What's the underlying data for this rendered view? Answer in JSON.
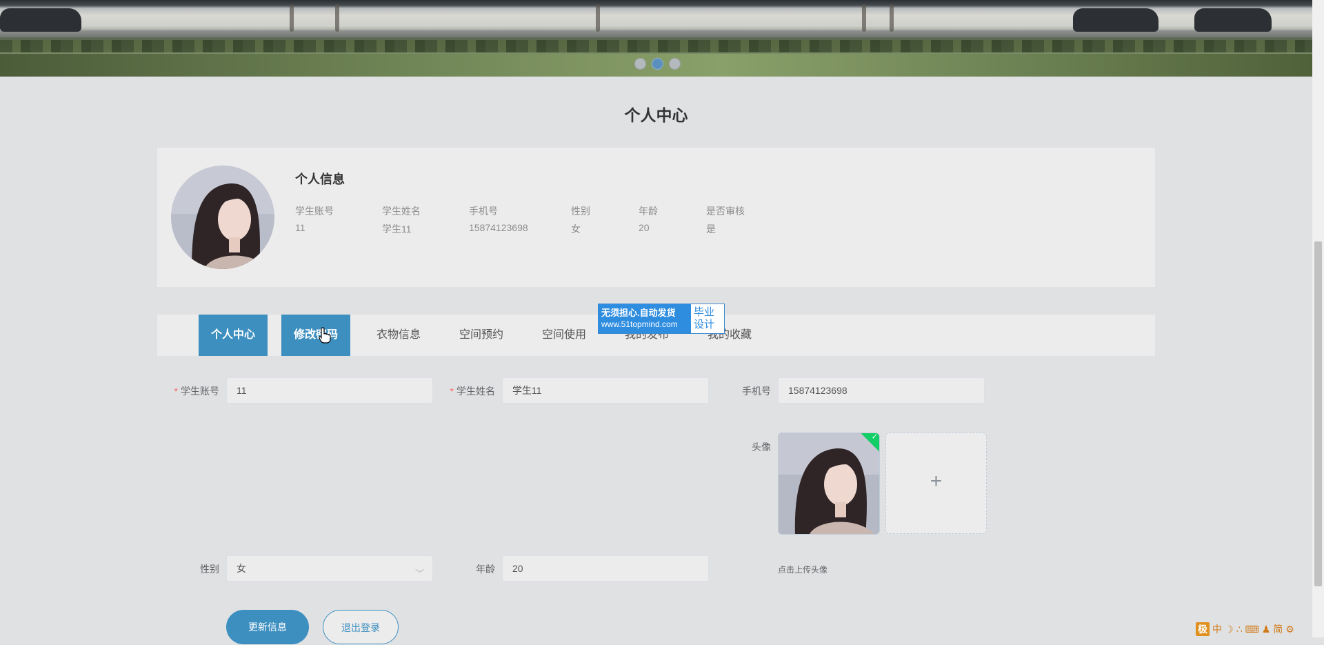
{
  "page_title": "个人中心",
  "info": {
    "title": "个人信息",
    "fields": [
      {
        "label": "学生账号",
        "value": "11"
      },
      {
        "label": "学生姓名",
        "value": "学生11"
      },
      {
        "label": "手机号",
        "value": "15874123698"
      },
      {
        "label": "性别",
        "value": "女"
      },
      {
        "label": "年龄",
        "value": "20"
      },
      {
        "label": "是否审核",
        "value": "是"
      }
    ]
  },
  "tabs": [
    {
      "label": "个人中心",
      "active": true
    },
    {
      "label": "修改密码",
      "active": true
    },
    {
      "label": "衣物信息"
    },
    {
      "label": "空间预约"
    },
    {
      "label": "空间使用"
    },
    {
      "label": "我的发布"
    },
    {
      "label": "我的收藏"
    }
  ],
  "promo": {
    "line1": "无须担心.自动发货",
    "line2": "www.51topmind.com",
    "right1": "毕业",
    "right2": "设计"
  },
  "form": {
    "account": {
      "label": "学生账号",
      "value": "11"
    },
    "name": {
      "label": "学生姓名",
      "value": "学生11"
    },
    "phone": {
      "label": "手机号",
      "value": "15874123698"
    },
    "avatar": {
      "label": "头像",
      "hint": "点击上传头像"
    },
    "gender": {
      "label": "性别",
      "value": "女"
    },
    "age": {
      "label": "年龄",
      "value": "20"
    }
  },
  "buttons": {
    "update": "更新信息",
    "logout": "退出登录"
  },
  "tray": {
    "ime1": "极",
    "ime2": "中",
    "ime3": "简"
  }
}
